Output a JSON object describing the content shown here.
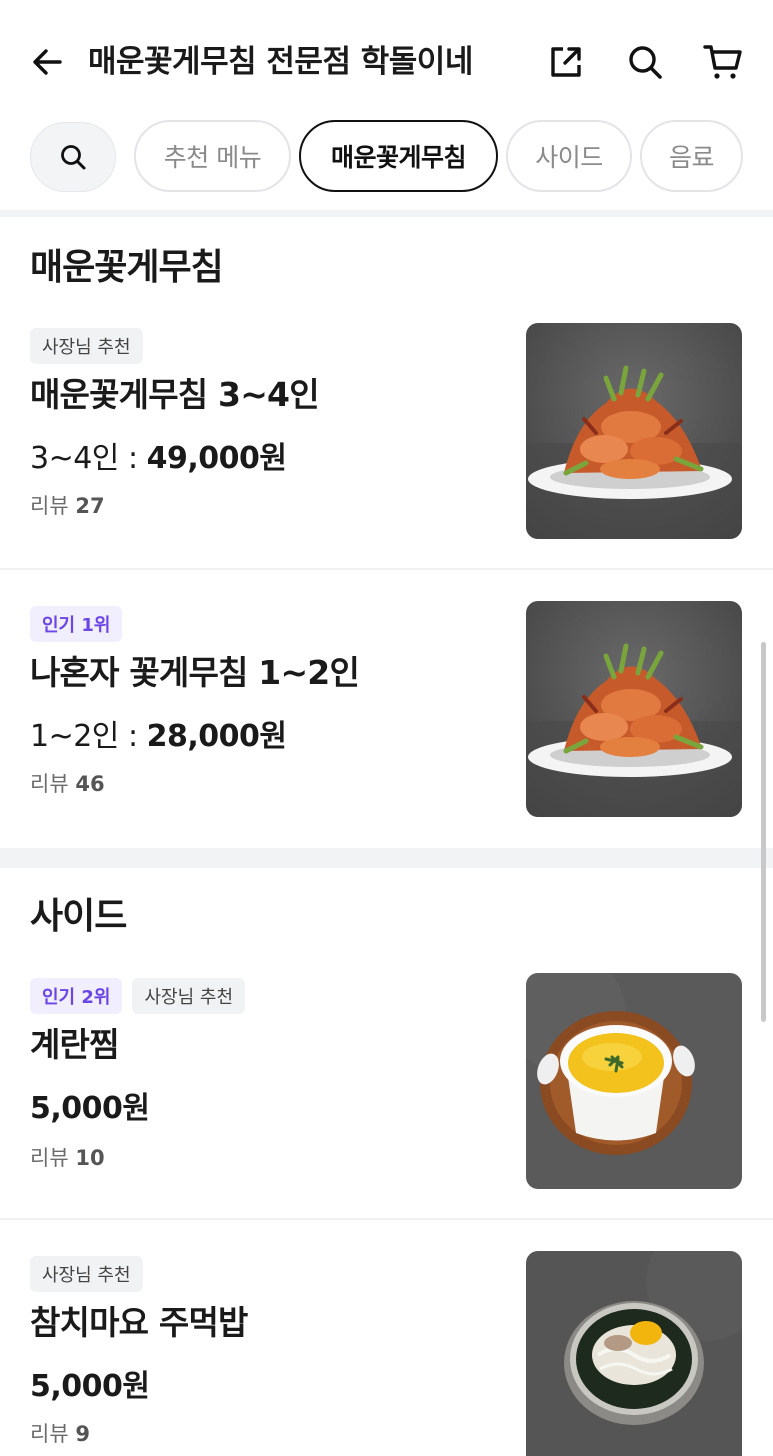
{
  "header": {
    "title": "매운꽃게무침 전문점 학돌이네",
    "icons": {
      "back": "arrow-left-icon",
      "share": "share-icon",
      "search": "search-icon",
      "cart": "cart-icon"
    }
  },
  "tabs": [
    {
      "label": "추천 메뉴",
      "active": false
    },
    {
      "label": "매운꽃게무침",
      "active": true
    },
    {
      "label": "사이드",
      "active": false
    },
    {
      "label": "음료",
      "active": false
    }
  ],
  "sections": [
    {
      "title": "매운꽃게무침",
      "items": [
        {
          "badges": [
            "사장님 추천"
          ],
          "name": "매운꽃게무침 3~4인",
          "price_label": "3~4인 : ",
          "price": "49,000원",
          "review_label": "리뷰",
          "review_count": "27"
        },
        {
          "badges": [
            "인기 1위"
          ],
          "name": "나혼자 꽃게무침 1~2인",
          "price_label": "1~2인 : ",
          "price": "28,000원",
          "review_label": "리뷰",
          "review_count": "46"
        }
      ]
    },
    {
      "title": "사이드",
      "items": [
        {
          "badges": [
            "인기 2위",
            "사장님 추천"
          ],
          "name": "계란찜",
          "price_label": "",
          "price": "5,000원",
          "review_label": "리뷰",
          "review_count": "10"
        },
        {
          "badges": [
            "사장님 추천"
          ],
          "name": "참치마요 주먹밥",
          "price_label": "",
          "price": "5,000원",
          "review_label": "리뷰",
          "review_count": "9"
        }
      ]
    }
  ],
  "colors": {
    "rank_badge_text": "#6b46e6",
    "rank_badge_bg": "#f1eefd",
    "owner_badge_bg": "#f1f2f4",
    "divider": "#f2f3f5"
  }
}
